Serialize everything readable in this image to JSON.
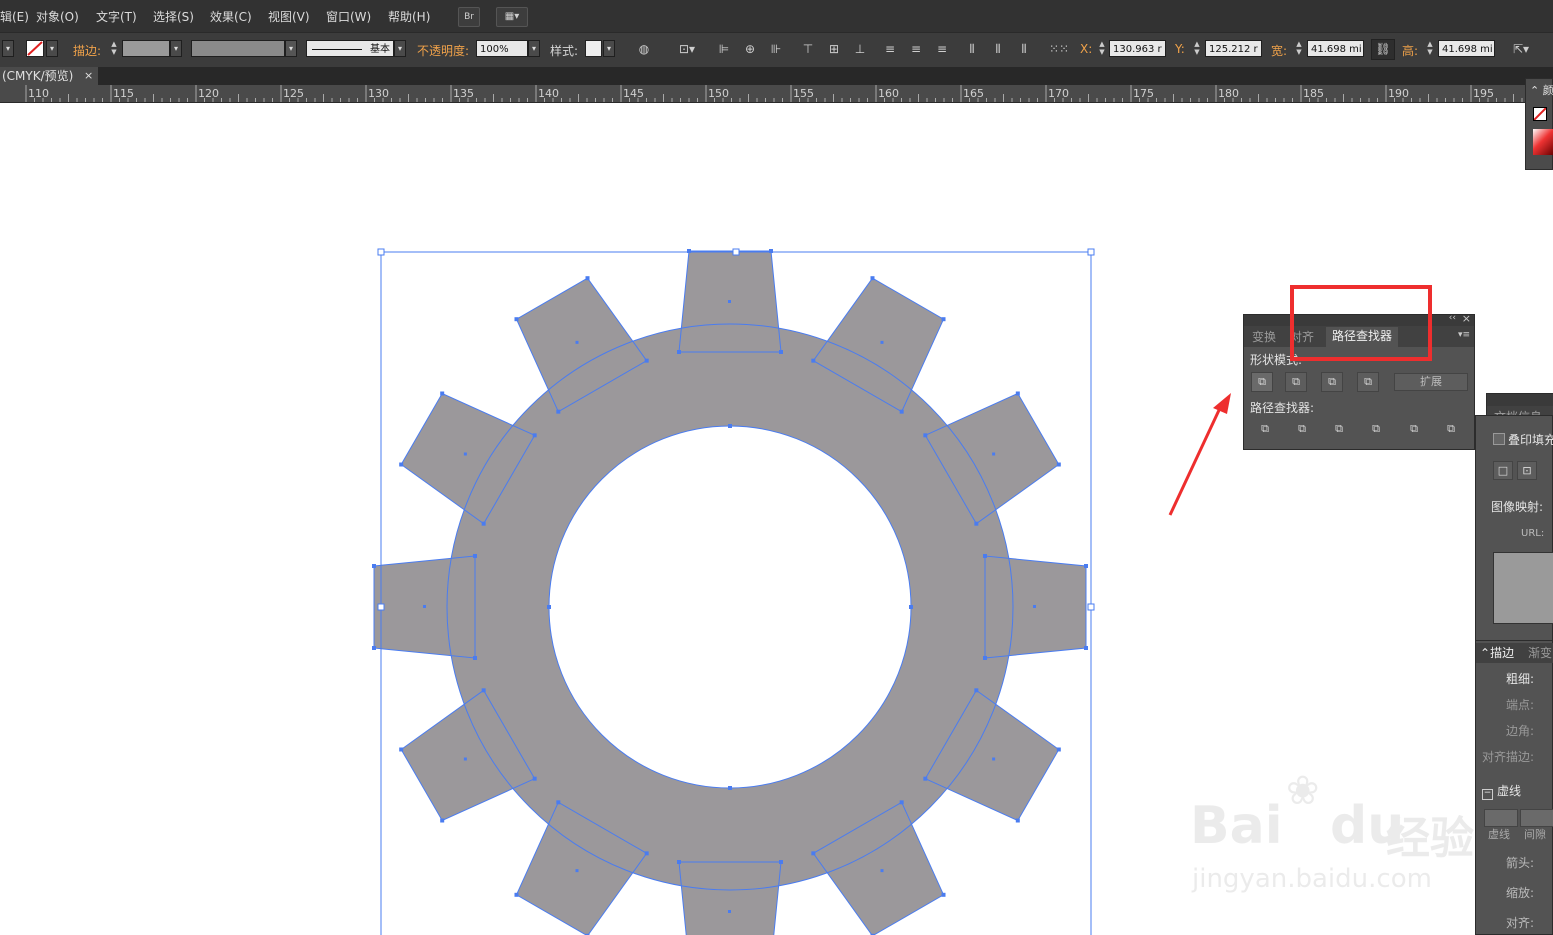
{
  "menu": {
    "items": [
      "辑(E)",
      "对象(O)",
      "文字(T)",
      "选择(S)",
      "效果(C)",
      "视图(V)",
      "窗口(W)",
      "帮助(H)"
    ],
    "bridge_label": "Br"
  },
  "control": {
    "stroke_label": "描边:",
    "stroke_style": "基本",
    "opacity_label": "不透明度:",
    "opacity_value": "100%",
    "style_label": "样式:",
    "x_label": "X:",
    "x_value": "130.963 r",
    "y_label": "Y:",
    "y_value": "125.212 r",
    "w_label": "宽:",
    "w_value": "41.698 mi",
    "h_label": "高:",
    "h_value": "41.698 mi"
  },
  "document": {
    "tab_title": "(CMYK/预览)",
    "close_glyph": "×"
  },
  "ruler": {
    "labels": [
      "110",
      "115",
      "120",
      "125",
      "130",
      "135",
      "140",
      "145",
      "150",
      "155",
      "160",
      "165",
      "170",
      "175",
      "180",
      "185",
      "190",
      "195"
    ]
  },
  "pathfinder": {
    "tabs": [
      "变换",
      "对齐",
      "路径查找器"
    ],
    "active_tab": "路径查找器",
    "shape_modes_label": "形状模式:",
    "expand_label": "扩展",
    "pathfinders_label": "路径查找器:",
    "collapse_glyph": "‹‹",
    "close_glyph": "×",
    "menu_glyph": "▾≡"
  },
  "color_panel": {
    "tab": "颜"
  },
  "doc_info_panel": {
    "tab": "文档信息",
    "overprint_label": "叠印填充",
    "image_map_label": "图像映射:",
    "url_label": "URL:"
  },
  "stroke_panel": {
    "tabs": [
      "描边",
      "渐变"
    ],
    "weight_label": "粗细:",
    "cap_label": "端点:",
    "corner_label": "边角:",
    "align_label": "对齐描边:",
    "dashed_label": "虚线",
    "dash_label": "虚线",
    "gap_label": "间隙",
    "arrow_label": "箭头:",
    "scale_label": "缩放:",
    "align2_label": "对齐:"
  },
  "watermark": {
    "brand": "Bai",
    "brand_tail": "du",
    "suffix": "经验",
    "url": "jingyan.baidu.com"
  },
  "colors": {
    "gear_fill": "#9b989b",
    "path_stroke": "#4a7cf0",
    "highlight_box": "#ee2e2e",
    "arrow": "#ee2e2e",
    "ui_dark": "#323232",
    "accent_orange": "#f0a24a"
  }
}
